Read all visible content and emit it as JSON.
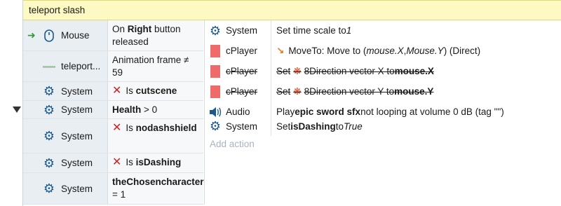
{
  "event": {
    "group_title": "teleport slash",
    "conditions": [
      {
        "object": "Mouse",
        "icon": "mouse-icon",
        "text_html": "On <b>Right</b> button released",
        "trigger_arrow": true
      },
      {
        "object": "teleport...",
        "icon": "sprite-line-icon",
        "text_html": "Animation frame ≠ 59"
      },
      {
        "object": "System",
        "icon": "gear-icon",
        "text_html": "<span class='red-x'>✕</span>Is <b>cutscene</b>"
      },
      {
        "object": "System",
        "icon": "gear-icon",
        "text_html": "<b>Health</b> &gt; 0"
      },
      {
        "object": "System",
        "icon": "gear-icon",
        "text_html": "<span class='red-x'>✕</span>Is <b>nodashshield</b>"
      },
      {
        "object": "System",
        "icon": "gear-icon",
        "text_html": "<span class='red-x'>✕</span>Is <b>isDashing</b>"
      },
      {
        "object": "System",
        "icon": "gear-icon",
        "text_html": "<b>theChosencharacter</b> = 1"
      }
    ],
    "actions": [
      {
        "object": "System",
        "icon": "gear-icon",
        "text_html": "Set time scale to <i>1</i>",
        "disabled": false
      },
      {
        "object": "cPlayer",
        "icon": "sprite-icon",
        "text_html": "<span style='color:#e07a1f;font-weight:bold;margin-right:6px'>↘</span>MoveTo: Move to (<i>mouse.X</i>, <i>Mouse.Y</i>) (Direct)",
        "disabled": false
      },
      {
        "object": "cPlayer",
        "icon": "sprite-icon",
        "text_html": "Set <span style='color:#e0461f;margin:0 4px'>❋</span>8Direction vector X to <b>mouse.X</b>",
        "disabled": true
      },
      {
        "object": "cPlayer",
        "icon": "sprite-icon",
        "text_html": "Set <span style='color:#e0461f;margin:0 4px'>❋</span>8Direction vector Y to <b>mouse.Y</b>",
        "disabled": true
      },
      {
        "object": "Audio",
        "icon": "speaker-icon",
        "text_html": "Play <b>epic sword sfx</b> not looping at volume 0 dB (tag \"\")",
        "disabled": false
      },
      {
        "object": "System",
        "icon": "gear-icon",
        "text_html": "Set <b>isDashing</b> to <i>True</i>",
        "disabled": false
      }
    ],
    "add_action_label": "Add action"
  }
}
